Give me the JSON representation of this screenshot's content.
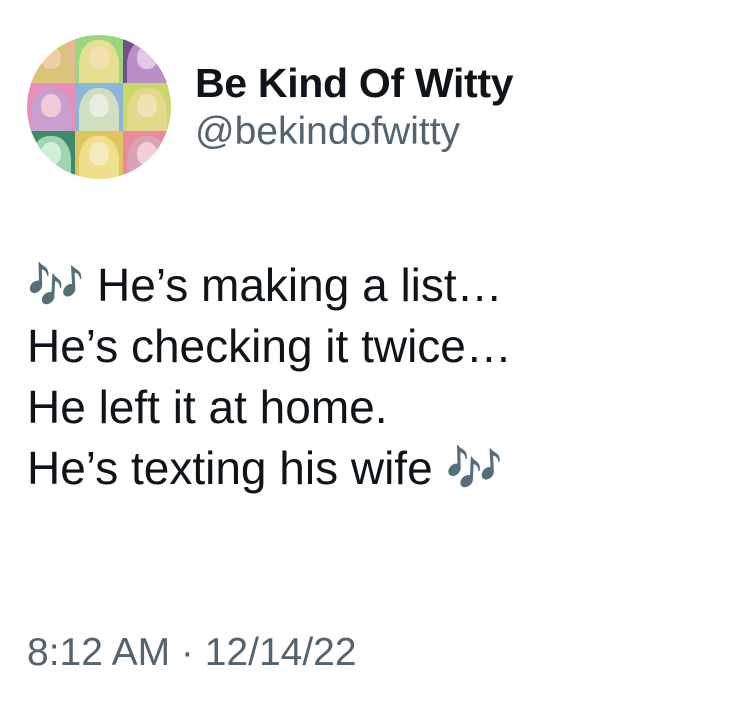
{
  "author": {
    "display_name": "Be Kind Of Witty",
    "handle": "@bekindofwitty"
  },
  "avatar": {
    "description_icon": "avatar-collage-icon",
    "tiles": [
      {
        "bg": "#e7b992",
        "hair": "#d9c47a",
        "face": "#f0cfa8"
      },
      {
        "bg": "#9ad57f",
        "hair": "#e4e090",
        "face": "#f2e0b0"
      },
      {
        "bg": "#6f4f8c",
        "hair": "#b98fc5",
        "face": "#e6c8e6"
      },
      {
        "bg": "#e68fb9",
        "hair": "#c7a0d0",
        "face": "#f3c9dc"
      },
      {
        "bg": "#8ab7d8",
        "hair": "#cfdfc0",
        "face": "#e6eedd"
      },
      {
        "bg": "#c9d86a",
        "hair": "#e3d98a",
        "face": "#f1e4b4"
      },
      {
        "bg": "#3f8a6a",
        "hair": "#9fd5b0",
        "face": "#d4efd8"
      },
      {
        "bg": "#e0c45f",
        "hair": "#f0e08e",
        "face": "#f6ebbe"
      },
      {
        "bg": "#e88a9c",
        "hair": "#d9a3b4",
        "face": "#f4cfd6"
      }
    ]
  },
  "tweet": {
    "lines": [
      "🎶 He’s making a list…",
      "He’s checking it twice…",
      "He left it at home.",
      "He’s texting his wife 🎶"
    ]
  },
  "meta": {
    "timestamp": "8:12 AM · 12/14/22"
  },
  "colors": {
    "text_primary": "#0f1419",
    "text_secondary": "#536471",
    "background": "#ffffff"
  }
}
